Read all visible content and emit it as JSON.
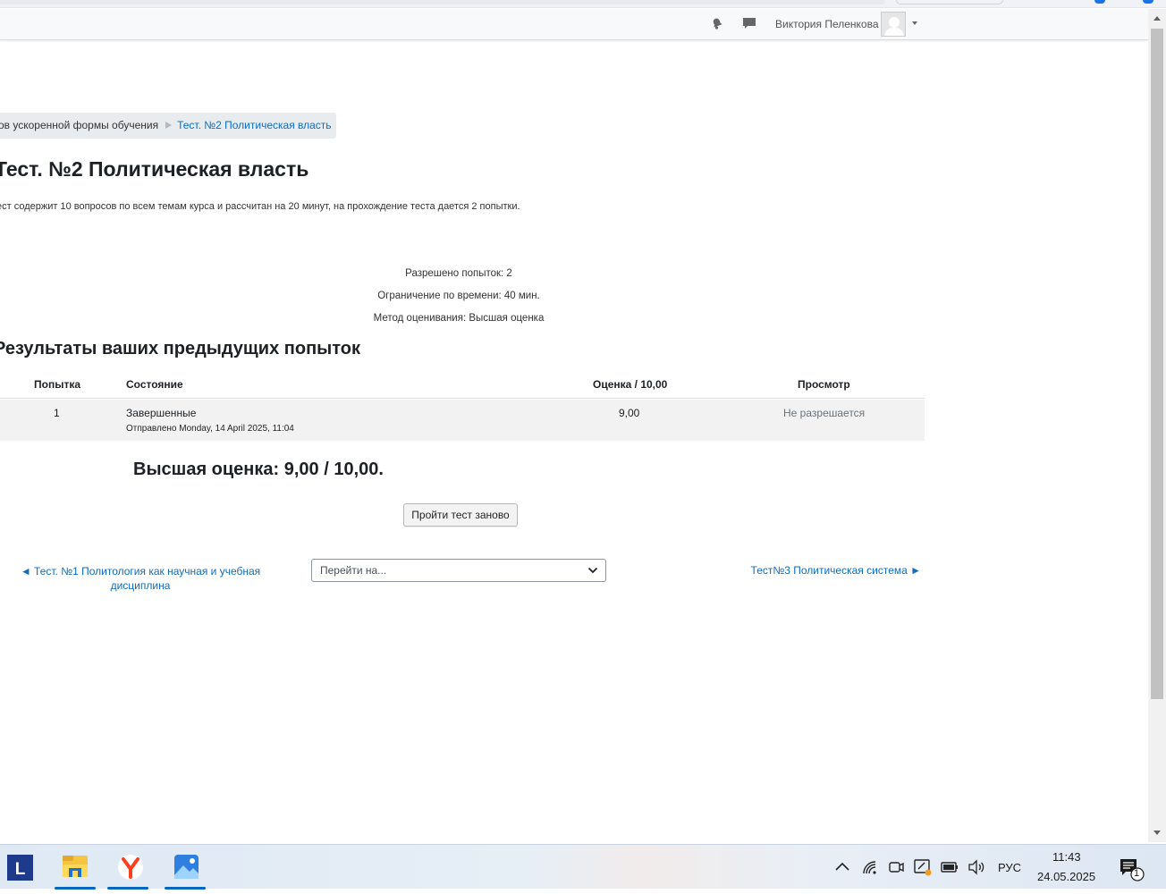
{
  "navbar": {
    "user_name": "Виктория Пеленкова"
  },
  "breadcrumb": {
    "items": [
      "ов ускоренной формы обучения",
      "Тест. №2 Политическая власть"
    ]
  },
  "page": {
    "title": "Тест. №2 Политическая власть",
    "intro": "ест содержит 10 вопросов по всем темам курса и рассчитан на 20 минут, на прохождение теста дается 2 попытки."
  },
  "quiz_info": {
    "attempts_allowed": "Разрешено попыток: 2",
    "time_limit": "Ограничение по времени: 40 мин.",
    "grading_method": "Метод оценивания: Высшая оценка"
  },
  "results": {
    "title": "езультаты ваших предыдущих попыток",
    "columns": [
      "Попытка",
      "Состояние",
      "Оценка / 10,00",
      "Просмотр"
    ],
    "rows": [
      {
        "attempt": "1",
        "state": "Завершенные",
        "submitted": "Отправлено Monday, 14 April 2025, 11:04",
        "grade": "9,00",
        "review": "Не разрешается"
      }
    ]
  },
  "best_grade": "Высшая оценка: 9,00 / 10,00.",
  "retry_button": "Пройти тест заново",
  "activity_nav": {
    "prev": "◄ Тест. №1 Политология как научная и учебная дисциплина",
    "jump_placeholder": "Перейти на...",
    "next": "Тест№3 Политическая система ►"
  },
  "taskbar": {
    "apps": [
      "L-app-icon",
      "file-explorer-icon",
      "yandex-browser-icon",
      "photos-icon"
    ],
    "language": "РУС",
    "time": "11:43",
    "date": "24.05.2025",
    "notification_count": "1"
  },
  "colors": {
    "link": "#0f6cbf",
    "accent": "#0067c0"
  }
}
